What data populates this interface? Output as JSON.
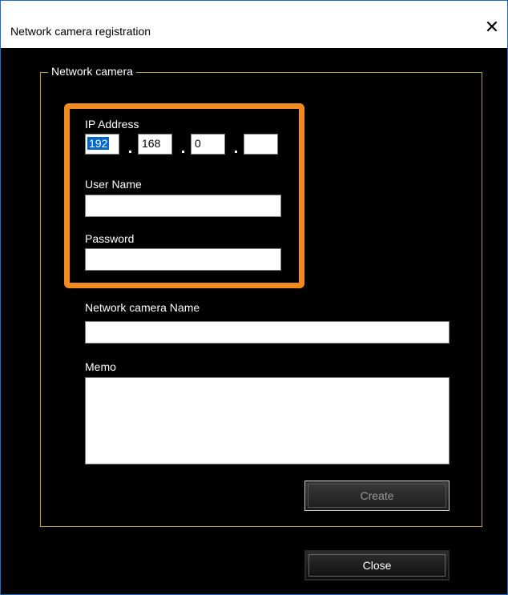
{
  "window": {
    "title": "Network camera registration",
    "close_glyph": "✕"
  },
  "group": {
    "legend": "Network camera"
  },
  "ip_address": {
    "label": "IP Address",
    "octets": [
      "192",
      "168",
      "0",
      ""
    ]
  },
  "user_name": {
    "label": "User Name",
    "value": ""
  },
  "password": {
    "label": "Password",
    "value": ""
  },
  "camera_name": {
    "label": "Network camera Name",
    "value": ""
  },
  "memo": {
    "label": "Memo",
    "value": ""
  },
  "buttons": {
    "create": "Create",
    "close": "Close"
  },
  "colors": {
    "highlight": "#f28a1f",
    "group_border": "#b5a030",
    "selection": "#0066cc"
  }
}
